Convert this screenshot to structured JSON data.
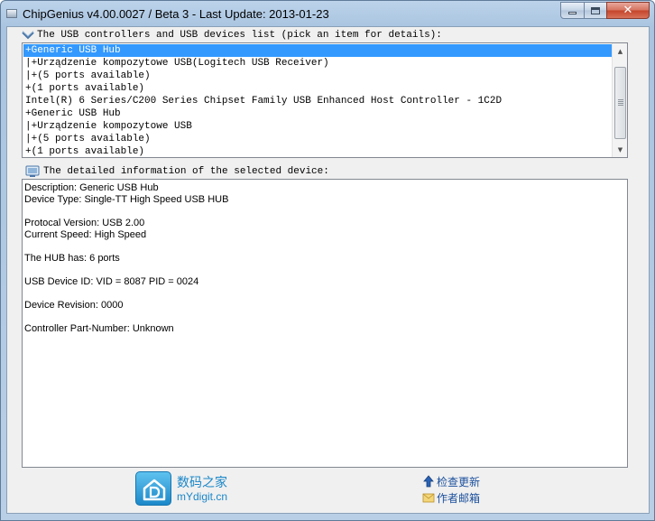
{
  "window": {
    "title": "ChipGenius v4.00.0027 / Beta 3 - Last Update: 2013-01-23",
    "close_glyph": "✕"
  },
  "device_list": {
    "label": "The USB controllers and USB devices list (pick an item for details):",
    "items": [
      {
        "text": "+Generic USB Hub",
        "selected": true
      },
      {
        "text": "|+Urządzenie kompozytowe USB(Logitech USB Receiver)",
        "selected": false
      },
      {
        "text": "|+(5 ports available)",
        "selected": false
      },
      {
        "text": "+(1 ports available)",
        "selected": false
      },
      {
        "text": "Intel(R) 6 Series/C200 Series Chipset Family USB Enhanced Host Controller - 1C2D",
        "selected": false
      },
      {
        "text": "+Generic USB Hub",
        "selected": false
      },
      {
        "text": "|+Urządzenie kompozytowe USB",
        "selected": false
      },
      {
        "text": "|+(5 ports available)",
        "selected": false
      },
      {
        "text": "+(1 ports available)",
        "selected": false
      }
    ]
  },
  "details": {
    "label": "The detailed information of the selected device:",
    "lines": [
      "Description: Generic USB Hub",
      "Device Type: Single-TT High Speed USB HUB",
      "Protocal Version: USB 2.00",
      "Current Speed: High Speed",
      "The HUB has: 6 ports",
      "USB Device ID: VID = 8087 PID = 0024",
      "Device Revision: 0000",
      "Controller Part-Number: Unknown"
    ]
  },
  "footer": {
    "logo_cn": "数码之家",
    "logo_en": "mYdigit.cn",
    "check_update": "检查更新",
    "author_mail": "作者邮箱"
  },
  "colors": {
    "selection": "#3399ff",
    "logo_blue": "#1a87c9",
    "link_blue": "#1a4f9c"
  }
}
